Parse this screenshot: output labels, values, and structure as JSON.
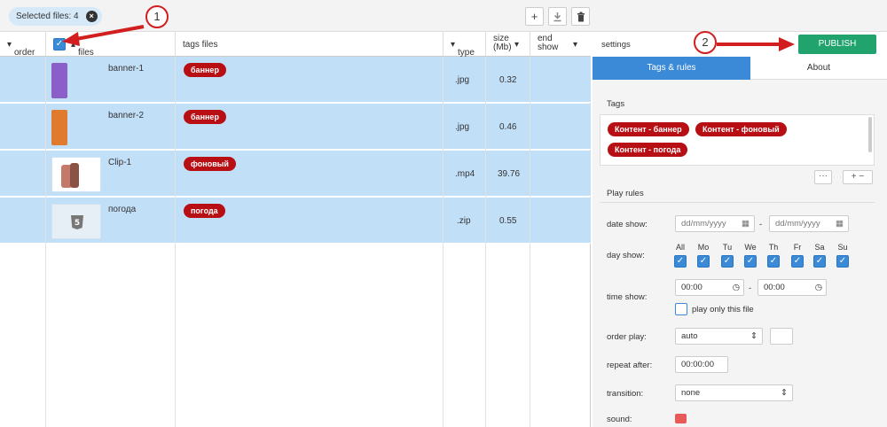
{
  "topbar": {
    "selected_label": "Selected files: 4",
    "buttons": [
      {
        "icon": "plus-icon",
        "glyph": "+"
      },
      {
        "icon": "download-icon",
        "glyph": "⭳"
      },
      {
        "icon": "trash-icon",
        "glyph": "🗑"
      }
    ]
  },
  "table": {
    "columns": {
      "order": "order",
      "files": "files",
      "tags": "tags files",
      "type": "type",
      "size": "size (Mb)",
      "end_show": "end show"
    },
    "rows": [
      {
        "name": "banner-1",
        "tag": "баннер",
        "type": ".jpg",
        "size": "0.32",
        "thumb_icon": "banner-thumbnail"
      },
      {
        "name": "banner-2",
        "tag": "баннер",
        "type": ".jpg",
        "size": "0.46",
        "thumb_icon": "banner-thumbnail"
      },
      {
        "name": "Clip-1",
        "tag": "фоновый",
        "type": ".mp4",
        "size": "39.76",
        "thumb_icon": "video-thumbnail"
      },
      {
        "name": "погода",
        "tag": "погода",
        "type": ".zip",
        "size": "0.55",
        "thumb_icon": "html5-icon"
      }
    ]
  },
  "settings": {
    "title": "settings",
    "publish_label": "PUBLISH",
    "tabs": [
      "Tags & rules",
      "About"
    ],
    "tags_label": "Tags",
    "tags": [
      "Контент - баннер",
      "Контент - фоновый",
      "Контент - погода"
    ],
    "more_label": "···",
    "play_rules_label": "Play rules",
    "date_show_label": "date show:",
    "date_placeholder": "dd/mm/yyyy",
    "day_show_label": "day show:",
    "days": [
      "All",
      "Mo",
      "Tu",
      "We",
      "Th",
      "Fr",
      "Sa",
      "Su"
    ],
    "time_show_label": "time show:",
    "time_from": "00:00",
    "time_to": "00:00",
    "play_only_label": "play only this file",
    "order_play_label": "order play:",
    "order_play_value": "auto",
    "repeat_after_label": "repeat after:",
    "repeat_after_value": "00:00:00",
    "transition_label": "transition:",
    "transition_value": "none",
    "sound_label": "sound:",
    "dash": "-"
  },
  "callouts": [
    "1",
    "2"
  ],
  "colors": {
    "accent": "#3a8ad8",
    "tag": "#b80f14",
    "publish": "#21a36e",
    "row_selected": "#c2dff8",
    "annotation": "#d21e1e"
  }
}
